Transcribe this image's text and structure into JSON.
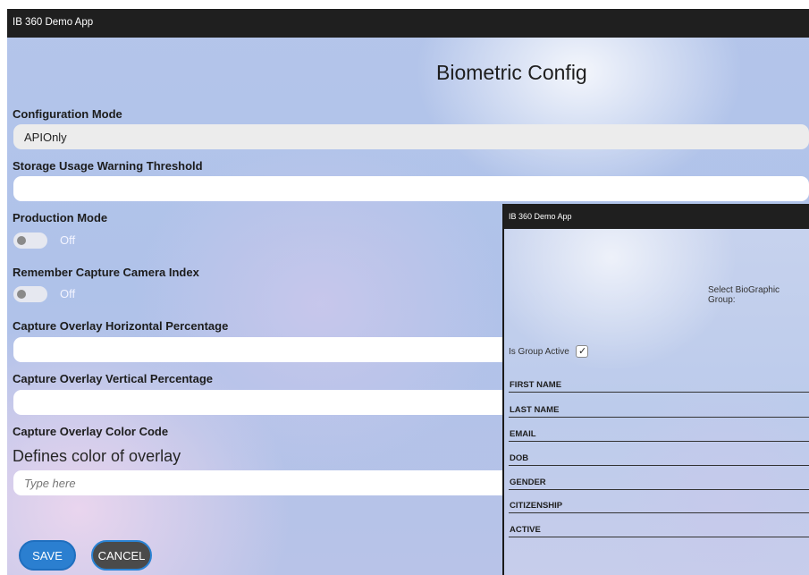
{
  "window": {
    "title": "IB 360 Demo App"
  },
  "page": {
    "title": "Biometric Config"
  },
  "fields": {
    "configuration_mode": {
      "label": "Configuration Mode",
      "value": "APIOnly"
    },
    "storage_threshold": {
      "label": "Storage Usage Warning Threshold",
      "value": ""
    },
    "production_mode": {
      "label": "Production Mode",
      "state": "Off"
    },
    "remember_camera": {
      "label": "Remember Capture Camera Index",
      "state": "Off"
    },
    "overlay_horizontal": {
      "label": "Capture Overlay Horizontal Percentage",
      "value": ""
    },
    "overlay_vertical": {
      "label": "Capture Overlay Vertical Percentage",
      "value": ""
    },
    "overlay_color": {
      "label": "Capture Overlay Color Code",
      "helper": "Defines color of overlay",
      "placeholder": "Type here"
    }
  },
  "buttons": {
    "save": "SAVE",
    "cancel": "CANCEL"
  },
  "overlay": {
    "title": "IB 360 Demo App",
    "group_select_label": "Select BioGraphic Group:",
    "group_active_label": "Is Group Active",
    "group_active_checked": true,
    "check_glyph": "✓",
    "columns": [
      "FIRST NAME",
      "LAST NAME",
      "EMAIL",
      "DOB",
      "GENDER",
      "CITIZENSHIP",
      "ACTIVE"
    ]
  },
  "colors": {
    "accent": "#2b7fd0",
    "title_bar": "#1f1f1f",
    "cancel_bg": "#4a4a4a"
  }
}
